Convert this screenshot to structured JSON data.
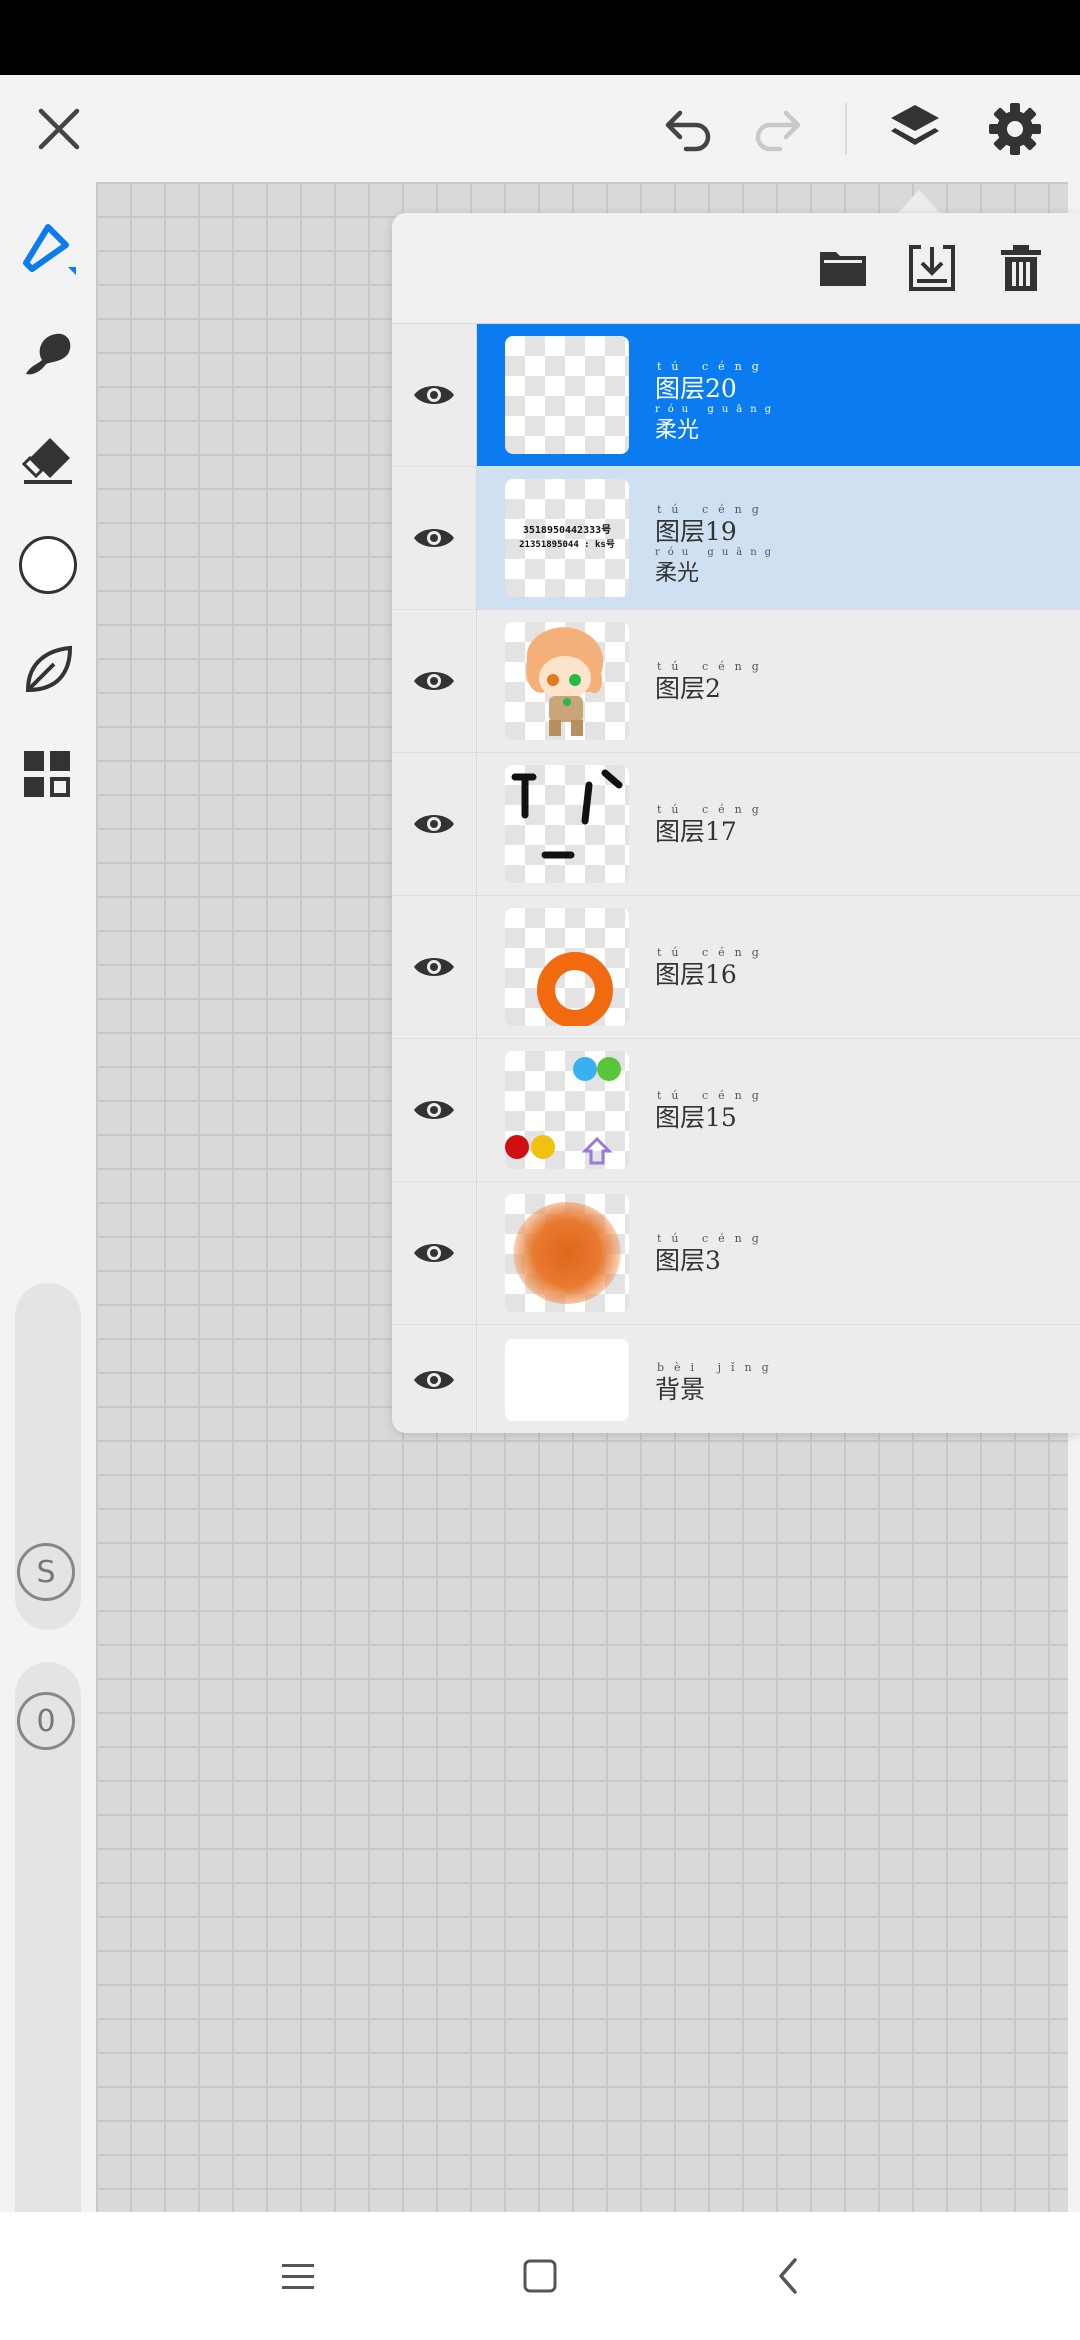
{
  "toolbar": {
    "close": "close-icon",
    "undo": "undo-icon",
    "redo": "redo-icon",
    "layers": "layers-icon",
    "settings": "gear-icon"
  },
  "tools": [
    "pen-icon",
    "smudge-icon",
    "eraser-icon",
    "color-swatch",
    "leaf-icon",
    "grid-icon"
  ],
  "side_controls": {
    "size_marker": "S",
    "opacity_marker": "0"
  },
  "layer_panel": {
    "actions": [
      "folder-icon",
      "merge-down-icon",
      "trash-icon"
    ],
    "layers": [
      {
        "name": "图层20",
        "ruby": "tú céng",
        "blend": "柔光",
        "blend_ruby": "róu guāng",
        "visible": true,
        "selected": true
      },
      {
        "name": "图层19",
        "ruby": "tú céng",
        "blend": "柔光",
        "blend_ruby": "róu guāng",
        "visible": true,
        "thumb_text_1": "3518950442333号",
        "thumb_text_2": "21351895044 : ks号"
      },
      {
        "name": "图层2",
        "ruby": "tú céng",
        "visible": true
      },
      {
        "name": "图层17",
        "ruby": "tú céng",
        "visible": true
      },
      {
        "name": "图层16",
        "ruby": "tú céng",
        "visible": true
      },
      {
        "name": "图层15",
        "ruby": "tú céng",
        "visible": true
      },
      {
        "name": "图层3",
        "ruby": "tú céng",
        "visible": true
      },
      {
        "name": "背景",
        "ruby": "bèi jǐng",
        "visible": true
      }
    ]
  },
  "navbar": [
    "menu-icon",
    "home-icon",
    "back-icon"
  ],
  "colors": {
    "accent": "#0a7cf0",
    "selected_secondary": "#cfe0f2",
    "orange": "#f26a10"
  }
}
